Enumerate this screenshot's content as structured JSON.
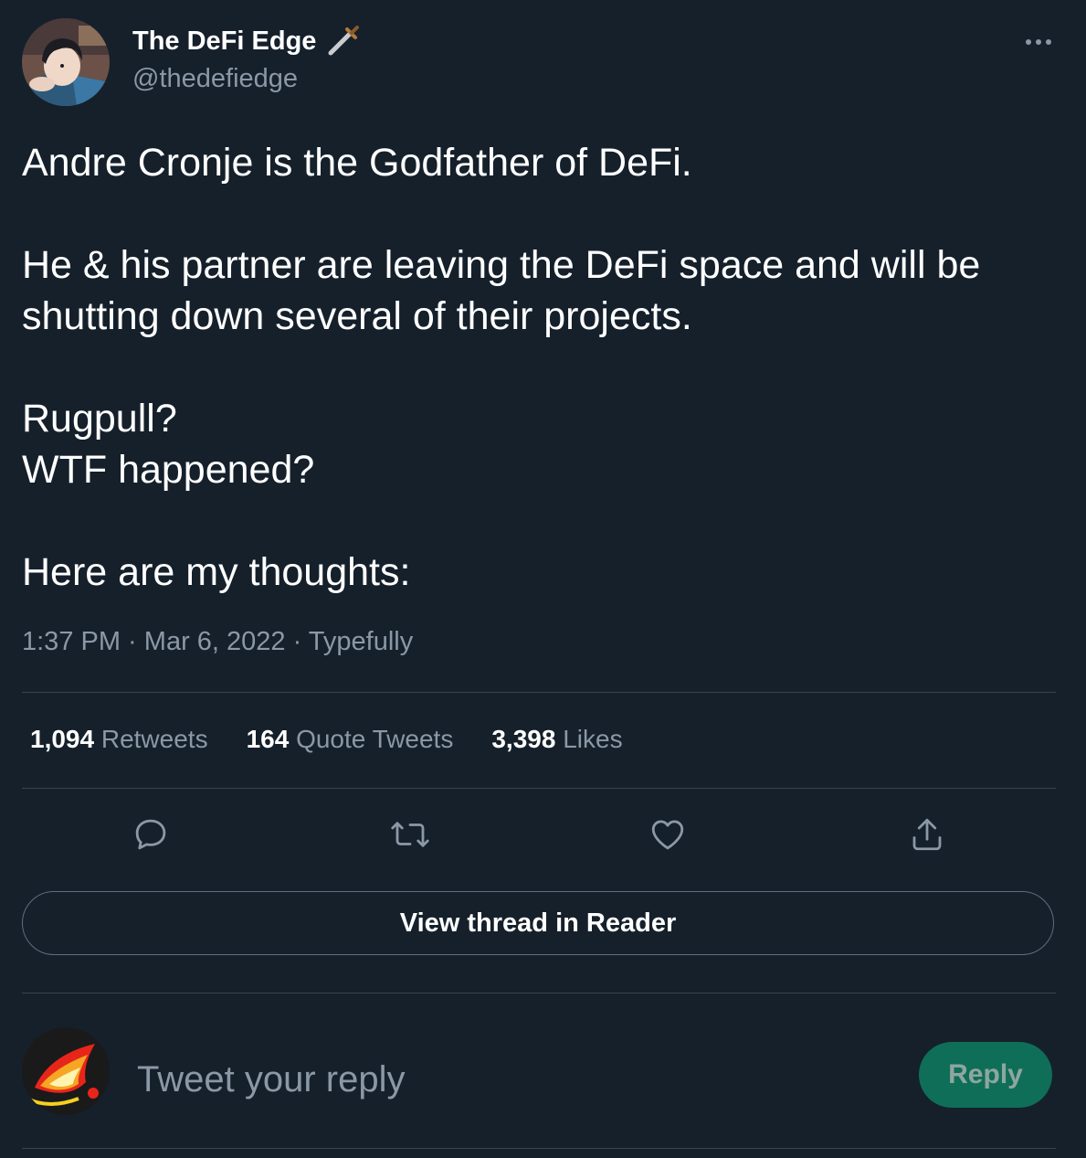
{
  "author": {
    "display_name": "The DeFi Edge",
    "handle": "@thedefiedge",
    "badge_icon": "dagger-icon",
    "avatar": "author-avatar"
  },
  "menu_icon": "more-horizontal-icon",
  "tweet": {
    "lines": {
      "p1": "Andre Cronje is the Godfather of DeFi.",
      "p2a": "He & his partner are leaving the DeFi space and will be",
      "p2b": "shutting down several of their projects.",
      "p3a": "Rugpull?",
      "p3b": "WTF happened?",
      "p4": "Here are my thoughts:"
    },
    "time": "1:37 PM",
    "separator": " · ",
    "date": "Mar 6, 2022",
    "source": "Typefully"
  },
  "stats": {
    "retweets_count": "1,094",
    "retweets_label": "Retweets",
    "quotes_count": "164",
    "quotes_label": "Quote Tweets",
    "likes_count": "3,398",
    "likes_label": "Likes"
  },
  "actions": [
    "reply-icon",
    "retweet-icon",
    "like-icon",
    "share-icon"
  ],
  "reader_button": "View thread in Reader",
  "composer": {
    "placeholder": "Tweet your reply",
    "value": "",
    "reply_button": "Reply"
  },
  "colors": {
    "background": "#15202b",
    "text": "#ffffff",
    "secondary": "#8b98a5",
    "divider": "#38444d",
    "reply_button": "#0f6e57"
  }
}
